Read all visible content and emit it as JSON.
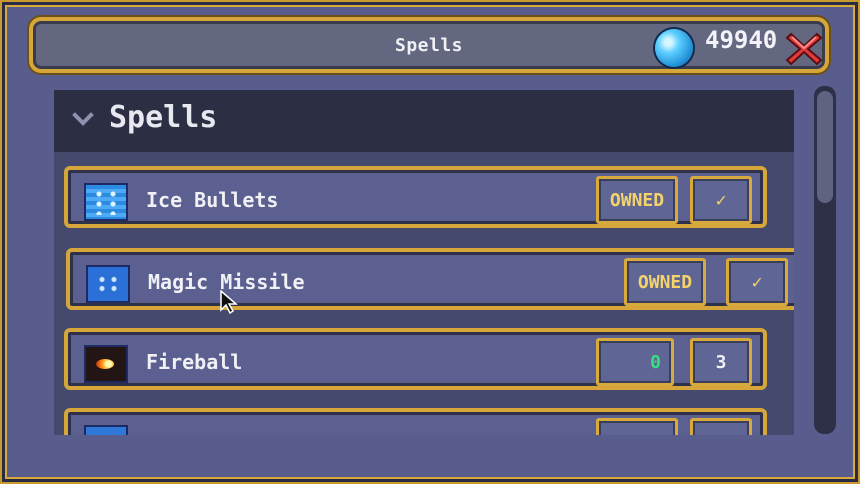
{
  "window": {
    "title": "Spells",
    "coins": "49940",
    "accent_gold": "#d6a63a",
    "panel_bg": "#45496d",
    "row_bg": "#5b6090"
  },
  "panel": {
    "header": "Spells",
    "rows": [
      {
        "label": "Ice Bullets",
        "slot1": "OWNED",
        "slot2": "✓",
        "icon": "ice-bullets-icon"
      },
      {
        "label": "Magic Missile",
        "slot1": "OWNED",
        "slot2": "✓",
        "icon": "magic-missile-icon"
      },
      {
        "label": "Fireball",
        "slot1": "0",
        "slot2": "3",
        "icon": "fireball-icon"
      },
      {
        "label": "",
        "slot1": "",
        "slot2": "",
        "icon": "spell-icon"
      }
    ]
  }
}
